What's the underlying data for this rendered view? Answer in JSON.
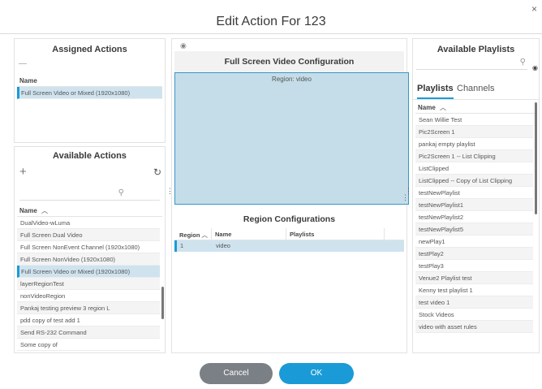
{
  "dialog": {
    "title": "Edit Action For 123",
    "close_glyph": "×"
  },
  "assigned": {
    "title": "Assigned Actions",
    "collapse_glyph": "—",
    "col_name": "Name",
    "rows": [
      "Full Screen Video or Mixed (1920x1080)"
    ]
  },
  "available": {
    "title": "Available Actions",
    "add_glyph": "+",
    "refresh_glyph": "↻",
    "search_glyph": "⚲",
    "col_name": "Name",
    "sort_glyph": "︿",
    "rows": [
      "DualVideo-wLuma",
      "Full Screen Dual Video",
      "Full Screen NonEvent Channel (1920x1080)",
      "Full Screen NonVideo (1920x1080)",
      "Full Screen Video or Mixed (1920x1080)",
      "layerRegionTest",
      "nonVideoRegion",
      "Pankaj testing preview 3 region L",
      "pdd copy of test add 1",
      "Send RS-232 Command",
      "Some copy of"
    ],
    "selected_index": 4
  },
  "center": {
    "eye_glyph": "◉",
    "config_title": "Full Screen Video Configuration",
    "region_label": "Region: video",
    "handle_glyph": "⋮",
    "regions_title": "Region Configurations",
    "col_region": "Region",
    "col_name": "Name",
    "col_playlists": "Playlists",
    "sort_glyph": "︿",
    "rows": [
      {
        "region": "1",
        "name": "video",
        "playlists": ""
      }
    ]
  },
  "playlists": {
    "title": "Available Playlists",
    "search_glyph": "⚲",
    "eye_glyph": "◉",
    "tabs": [
      "Playlists",
      "Channels"
    ],
    "active_tab": 0,
    "col_name": "Name",
    "sort_glyph": "︿",
    "rows": [
      "Sean Willie Test",
      "Pic2Screen 1",
      "pankaj empty playlist",
      "Pic2Screen 1 -- List Clipping",
      "ListClipped",
      "ListClipped -- Copy of List Clipping",
      "testNewPlaylist",
      "testNewPlaylist1",
      "testNewPlaylist2",
      "testNewPlaylist5",
      "newPlay1",
      "testPlay2",
      "testPlay3",
      "Venue2 Playlist test",
      "Kenny test playlist 1",
      "test video 1",
      "Stock Videos",
      "video with asset rules"
    ]
  },
  "footer": {
    "cancel_label": "Cancel",
    "ok_label": "OK"
  },
  "colors": {
    "accent": "#1a9bd7",
    "selected_row": "#cfe3ef",
    "region_fill": "#c4dde8",
    "cancel": "#7b8087"
  }
}
